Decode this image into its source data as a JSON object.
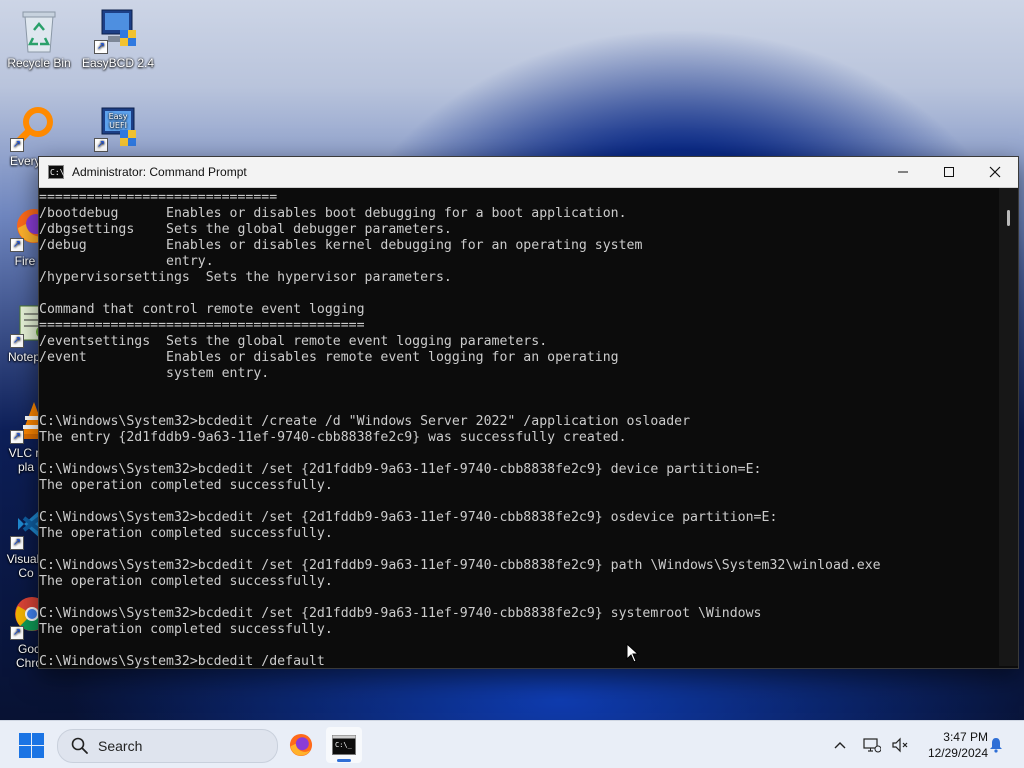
{
  "desktop": {
    "icons": [
      {
        "label": "Recycle Bin"
      },
      {
        "label": "EasyBCD 2.4"
      },
      {
        "label": "Every"
      },
      {
        "label": "Easy UEFI"
      },
      {
        "label": "Fire"
      },
      {
        "label": "Notep"
      },
      {
        "label": "VLC r"
      },
      {
        "label": "pla"
      },
      {
        "label": "Visual"
      },
      {
        "label": "Co"
      },
      {
        "label": "Goc"
      },
      {
        "label": "Chrome"
      }
    ]
  },
  "window": {
    "title": "Administrator: Command Prompt",
    "icon_text": "C:\\_",
    "controls": {
      "minimize": "—",
      "maximize": "☐",
      "close": "✕"
    }
  },
  "console": {
    "lines": [
      "==============================",
      "/bootdebug      Enables or disables boot debugging for a boot application.",
      "/dbgsettings    Sets the global debugger parameters.",
      "/debug          Enables or disables kernel debugging for an operating system",
      "                entry.",
      "/hypervisorsettings  Sets the hypervisor parameters.",
      "",
      "Command that control remote event logging",
      "=========================================",
      "/eventsettings  Sets the global remote event logging parameters.",
      "/event          Enables or disables remote event logging for an operating",
      "                system entry.",
      "",
      "",
      "C:\\Windows\\System32>bcdedit /create /d \"Windows Server 2022\" /application osloader",
      "The entry {2d1fddb9-9a63-11ef-9740-cbb8838fe2c9} was successfully created.",
      "",
      "C:\\Windows\\System32>bcdedit /set {2d1fddb9-9a63-11ef-9740-cbb8838fe2c9} device partition=E:",
      "The operation completed successfully.",
      "",
      "C:\\Windows\\System32>bcdedit /set {2d1fddb9-9a63-11ef-9740-cbb8838fe2c9} osdevice partition=E:",
      "The operation completed successfully.",
      "",
      "C:\\Windows\\System32>bcdedit /set {2d1fddb9-9a63-11ef-9740-cbb8838fe2c9} path \\Windows\\System32\\winload.exe",
      "The operation completed successfully.",
      "",
      "C:\\Windows\\System32>bcdedit /set {2d1fddb9-9a63-11ef-9740-cbb8838fe2c9} systemroot \\Windows",
      "The operation completed successfully.",
      "",
      "C:\\Windows\\System32>bcdedit /default"
    ]
  },
  "taskbar": {
    "search_placeholder": "Search",
    "clock_time": "3:47 PM",
    "clock_date": "12/29/2024"
  }
}
